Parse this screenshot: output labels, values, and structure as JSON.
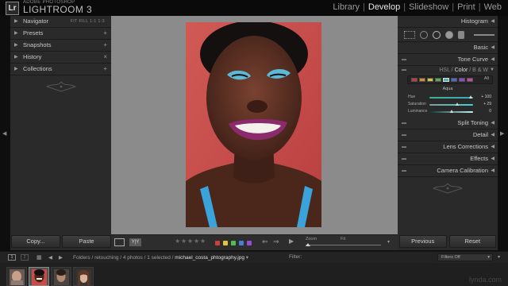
{
  "app": {
    "logo_text": "Lr",
    "brand_top": "ADOBE PHOTOSHOP",
    "brand_name": "LIGHTROOM 3",
    "modules": [
      "Library",
      "Develop",
      "Slideshow",
      "Print",
      "Web"
    ],
    "active_module": "Develop"
  },
  "left_panel": {
    "navigator": {
      "label": "Navigator",
      "options": "FIT  FILL  1:1  1:3"
    },
    "sections": [
      {
        "label": "Presets",
        "action": "+"
      },
      {
        "label": "Snapshots",
        "action": "+"
      },
      {
        "label": "History",
        "action": "×"
      },
      {
        "label": "Collections",
        "action": "+"
      }
    ],
    "copy_button": "Copy...",
    "paste_button": "Paste"
  },
  "toolbar": {
    "zoom_label": "Zoom",
    "fit_label": "Fit",
    "color_labels": [
      "#d63a3a",
      "#e2c43a",
      "#4fbf4a",
      "#4a7ed6",
      "#9b4ad6"
    ],
    "stars": 5
  },
  "right_panel": {
    "histogram_label": "Histogram",
    "basic_label": "Basic",
    "tone_curve_label": "Tone Curve",
    "hsl_tabs": {
      "hsl": "HSL",
      "sep1": "/",
      "color": "Color",
      "sep2": "/",
      "bw": "B & W"
    },
    "hsl_swatches": [
      "#c63a3a",
      "#d8893a",
      "#d8c43a",
      "#58b048",
      "#4ab8b8",
      "#4a6ad6",
      "#8a4ad6",
      "#c84aa8"
    ],
    "all_label": "All",
    "active_color": "Aqua",
    "sliders": [
      {
        "label": "Hue",
        "value": "+ 100",
        "level": 0.95,
        "gradient": [
          "#3bb58a",
          "#3aa6c9"
        ]
      },
      {
        "label": "Saturation",
        "value": "+ 29",
        "level": 0.64,
        "gradient": [
          "#7f9e99",
          "#3bd4d4"
        ]
      },
      {
        "label": "Luminance",
        "value": "0",
        "level": 0.5,
        "gradient": [
          "#0e3535",
          "#bff2f2"
        ]
      }
    ],
    "sections_below": [
      "Split Toning",
      "Detail",
      "Lens Corrections",
      "Effects",
      "Camera Calibration"
    ],
    "previous_button": "Previous",
    "reset_button": "Reset"
  },
  "filmstrip_bar": {
    "screen1": "1",
    "screen2": "2",
    "path": "Folders / retouching / 4 photos / 1 selected /",
    "filename": "michael_costa_phtography.jpg",
    "filter_label": "Filter:",
    "filters_off": "Filters Off"
  },
  "watermark": "lynda.com",
  "colors": {
    "panel_bg": "#2a2a2a",
    "center_bg": "#8b8b8b",
    "active_text": "#e8e8e8",
    "photo_bg": "#c94c48"
  }
}
